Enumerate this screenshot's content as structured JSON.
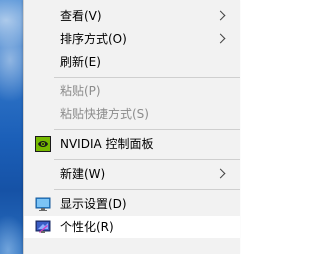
{
  "menu": {
    "items": [
      {
        "label": "查看(V)",
        "submenu": true
      },
      {
        "label": "排序方式(O)",
        "submenu": true
      },
      {
        "label": "刷新(E)"
      },
      {
        "label": "粘贴(P)",
        "disabled": true
      },
      {
        "label": "粘贴快捷方式(S)",
        "disabled": true
      },
      {
        "label": "NVIDIA 控制面板",
        "icon": "nvidia-icon"
      },
      {
        "label": "新建(W)",
        "submenu": true
      },
      {
        "label": "显示设置(D)",
        "icon": "display-settings-icon"
      },
      {
        "label": "个性化(R)",
        "icon": "personalize-icon",
        "highlighted": true
      }
    ]
  },
  "colors": {
    "menu_background": "#f2f2f2",
    "highlight": "#ffffff",
    "disabled_text": "#8c8c8c",
    "separator": "#cfcfcf",
    "nvidia_green": "#76b900"
  }
}
